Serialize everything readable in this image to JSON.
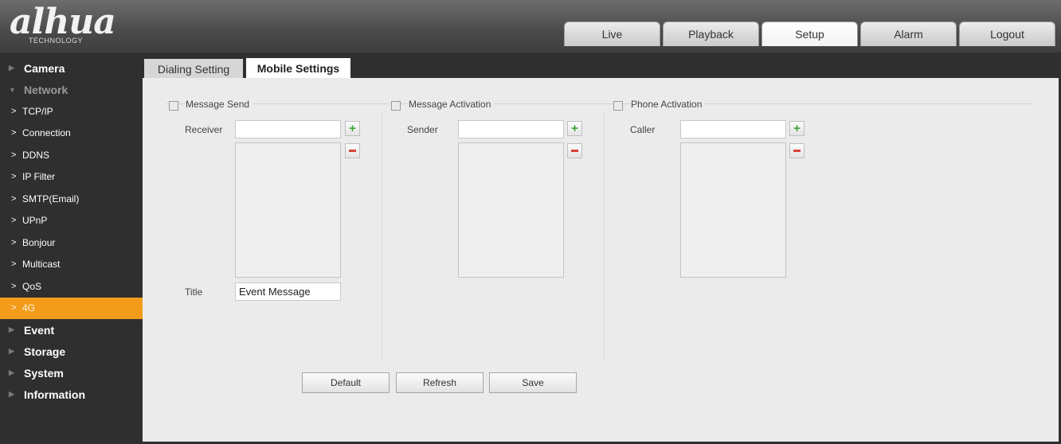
{
  "brand": {
    "logo_text": "alhua",
    "logo_sub": "TECHNOLOGY"
  },
  "nav": {
    "tabs": [
      "Live",
      "Playback",
      "Setup",
      "Alarm",
      "Logout"
    ],
    "active": "Setup"
  },
  "sidebar": {
    "sections": [
      "Camera",
      "Network",
      "Event",
      "Storage",
      "System",
      "Information"
    ],
    "network_items": [
      "TCP/IP",
      "Connection",
      "DDNS",
      "IP Filter",
      "SMTP(Email)",
      "UPnP",
      "Bonjour",
      "Multicast",
      "QoS",
      "4G"
    ],
    "active_item": "4G"
  },
  "subtabs": {
    "dialing": "Dialing Setting",
    "mobile": "Mobile Settings"
  },
  "message_send": {
    "checkbox_label": "Message Send",
    "receiver_label": "Receiver",
    "receiver_value": "",
    "title_label": "Title",
    "title_value": "Event Message"
  },
  "message_activation": {
    "checkbox_label": "Message Activation",
    "sender_label": "Sender",
    "sender_value": ""
  },
  "phone_activation": {
    "checkbox_label": "Phone Activation",
    "caller_label": "Caller",
    "caller_value": ""
  },
  "buttons": {
    "default": "Default",
    "refresh": "Refresh",
    "save": "Save"
  },
  "colors": {
    "active_item": "#f39c1c",
    "sidebar_bg": "#2f2f2f",
    "panel_bg": "#ebebeb"
  }
}
